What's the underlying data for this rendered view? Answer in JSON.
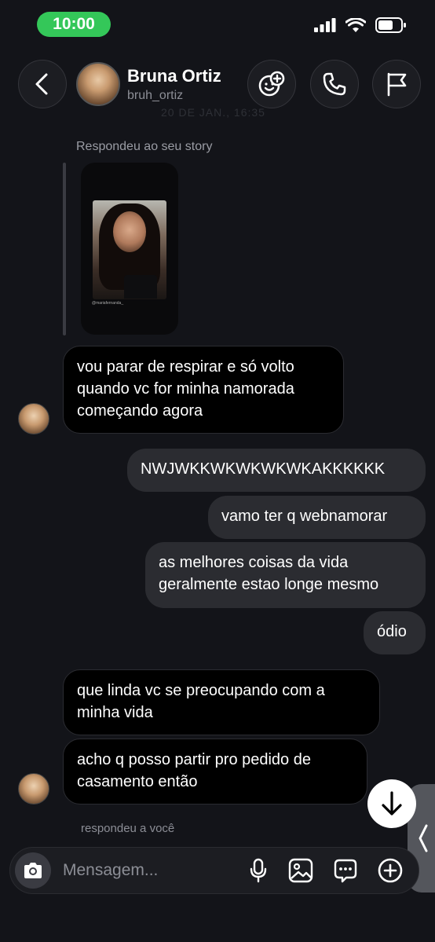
{
  "status_bar": {
    "time": "10:00"
  },
  "header": {
    "name": "Bruna Ortiz",
    "handle": "bruh_ortiz",
    "faded_date": "20 DE JAN., 16:35"
  },
  "story_reply": {
    "label": "Respondeu ao seu story",
    "caption": "@mariafernanda_"
  },
  "messages": [
    {
      "from": "them",
      "text": "vou parar de respirar e só volto quando vc for minha namorada começando agora"
    },
    {
      "from": "me",
      "text": "NWJWKKWKWKWKWKAKKKKKK"
    },
    {
      "from": "me",
      "text": "vamo ter q webnamorar"
    },
    {
      "from": "me",
      "text": "as melhores coisas da vida geralmente estao longe mesmo"
    },
    {
      "from": "me",
      "text": "ódio"
    },
    {
      "from": "them",
      "text": "que linda vc se preocupando com a minha vida"
    },
    {
      "from": "them",
      "text": "acho q posso partir pro pedido de casamento então"
    }
  ],
  "replied_you": "respondeu a você",
  "composer": {
    "placeholder": "Mensagem..."
  },
  "colors": {
    "background": "#131419",
    "status_pill": "#34c759",
    "outgoing_bubble": "#2b2c31",
    "incoming_bubble": "#000000"
  },
  "icons": [
    "back-icon",
    "sticker-add-icon",
    "phone-icon",
    "flag-icon",
    "chevron-down-icon",
    "camera-icon",
    "microphone-icon",
    "image-icon",
    "sticker-chat-icon",
    "plus-circle-icon",
    "chevron-left-icon"
  ]
}
